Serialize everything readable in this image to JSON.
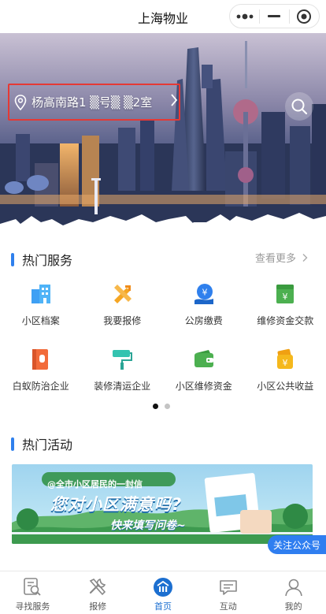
{
  "navbar": {
    "title": "上海物业",
    "more_icon": "more-dots-icon",
    "minimize_icon": "minimize-icon",
    "close_icon": "target-close-icon"
  },
  "banner": {
    "address": "杨高南路1 ▒号▒ ▒2室",
    "location_icon": "location-pin-icon",
    "search_icon": "search-icon"
  },
  "hot_services": {
    "title": "热门服务",
    "more": "查看更多",
    "items": [
      {
        "label": "小区档案",
        "icon": "building-icon",
        "color": "#3ea0f4"
      },
      {
        "label": "我要报修",
        "icon": "tools-icon",
        "color": "#f5a623"
      },
      {
        "label": "公房缴费",
        "icon": "yuan-payment-icon",
        "color": "#2f80ed"
      },
      {
        "label": "维修资金交款",
        "icon": "yuan-card-icon",
        "color": "#4cb050"
      },
      {
        "label": "白蚁防治企业",
        "icon": "pest-control-icon",
        "color": "#f26b3a"
      },
      {
        "label": "装修清运企业",
        "icon": "paint-roller-icon",
        "color": "#34c3b0"
      },
      {
        "label": "小区维修资金",
        "icon": "wallet-icon",
        "color": "#4cb050"
      },
      {
        "label": "小区公共收益",
        "icon": "yuan-bag-icon",
        "color": "#f5b81c"
      }
    ]
  },
  "hot_activities": {
    "title": "热门活动",
    "banner_line1": "@全市小区居民的一封信",
    "banner_line2": "您对小区满意吗?",
    "banner_line3": "快来填写问卷~"
  },
  "follow_button": "关注公众号",
  "tabbar": {
    "items": [
      {
        "label": "寻找服务",
        "icon": "find-service-icon"
      },
      {
        "label": "报修",
        "icon": "repair-tools-icon"
      },
      {
        "label": "首页",
        "icon": "home-icon"
      },
      {
        "label": "互动",
        "icon": "chat-icon"
      },
      {
        "label": "我的",
        "icon": "profile-icon"
      }
    ],
    "active_color": "#1c6fd0"
  }
}
